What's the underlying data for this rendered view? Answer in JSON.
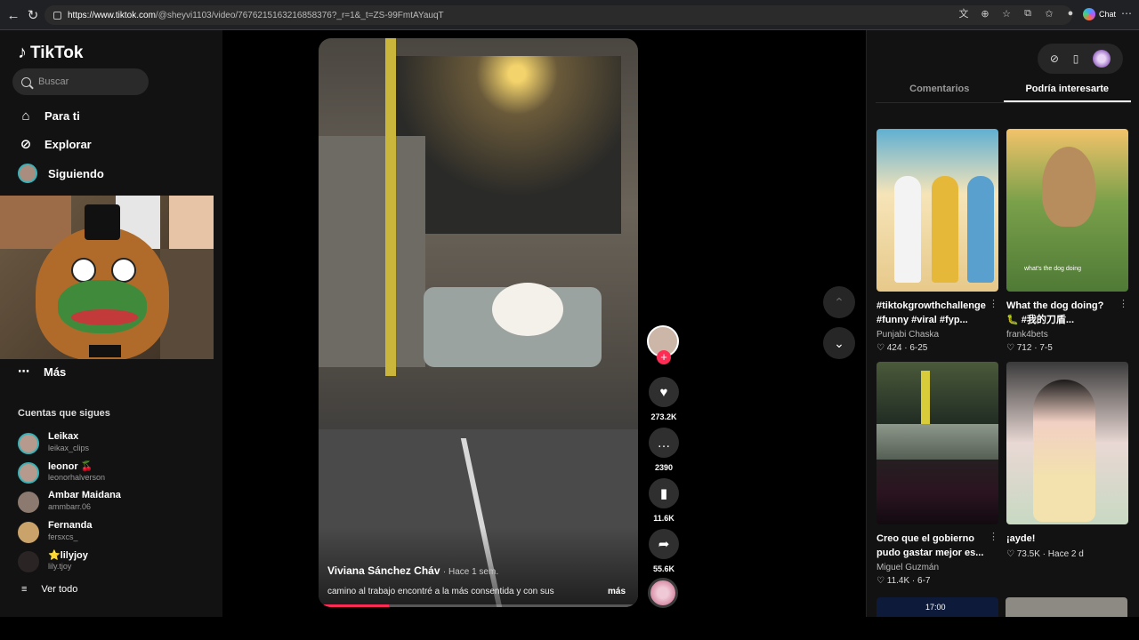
{
  "browser": {
    "url_host": "https://www.tiktok.com",
    "url_path": "/@sheyvi1103/video/7676215163216858376?_r=1&_t=ZS-99FmtAYauqT",
    "chat_label": "Chat"
  },
  "sidebar": {
    "logo": "TikTok",
    "search_placeholder": "Buscar",
    "nav": [
      {
        "label": "Para ti",
        "icon": "home-icon"
      },
      {
        "label": "Explorar",
        "icon": "compass-icon"
      },
      {
        "label": "Siguiendo",
        "icon": "avatar"
      }
    ],
    "more_label": "Más",
    "following_title": "Cuentas que sigues",
    "accounts": [
      {
        "name": "Leikax",
        "handle": "leikax_clips"
      },
      {
        "name": "leonor 🍒",
        "handle": "leonorhalverson"
      },
      {
        "name": "Ambar Maidana",
        "handle": "ammbarr.06"
      },
      {
        "name": "Fernanda",
        "handle": "fersxcs_"
      },
      {
        "name": "⭐lilyjoy",
        "handle": "lily.tjoy"
      }
    ],
    "see_all": "Ver todo"
  },
  "video": {
    "author": "Viviana Sánchez Cháv",
    "time": "· Hace 1 sem.",
    "caption": "camino al trabajo encontré a la más consentida y con sus",
    "more": "más",
    "progress": 0.22
  },
  "actions": {
    "likes": "273.2K",
    "comments": "2390",
    "saves": "11.6K",
    "shares": "55.6K"
  },
  "right_panel": {
    "tabs": [
      "Comentarios",
      "Podría interesarte"
    ],
    "active_tab": 1,
    "cards": [
      {
        "title": "#tiktokgrowthchallenge #funny #viral #fyp...",
        "author": "Punjabi Chaska",
        "likes": "424",
        "date": "6-25"
      },
      {
        "title": "What the dog doing? 🐛 #我的刀盾...",
        "author": "frank4bets",
        "likes": "712",
        "date": "7-5",
        "overlay": "what's the dog doing"
      },
      {
        "title": "Creo que el gobierno pudo gastar mejor es...",
        "author": "Miguel Guzmán",
        "likes": "11.4K",
        "date": "6-7"
      },
      {
        "title": "¡ayde!",
        "author": "",
        "likes": "73.5K",
        "date": "Hace 2 d"
      }
    ],
    "peek_time": "17:00"
  },
  "colors": {
    "accent": "#fe2c55",
    "ring": "#3ab2b8",
    "background": "#121212"
  }
}
